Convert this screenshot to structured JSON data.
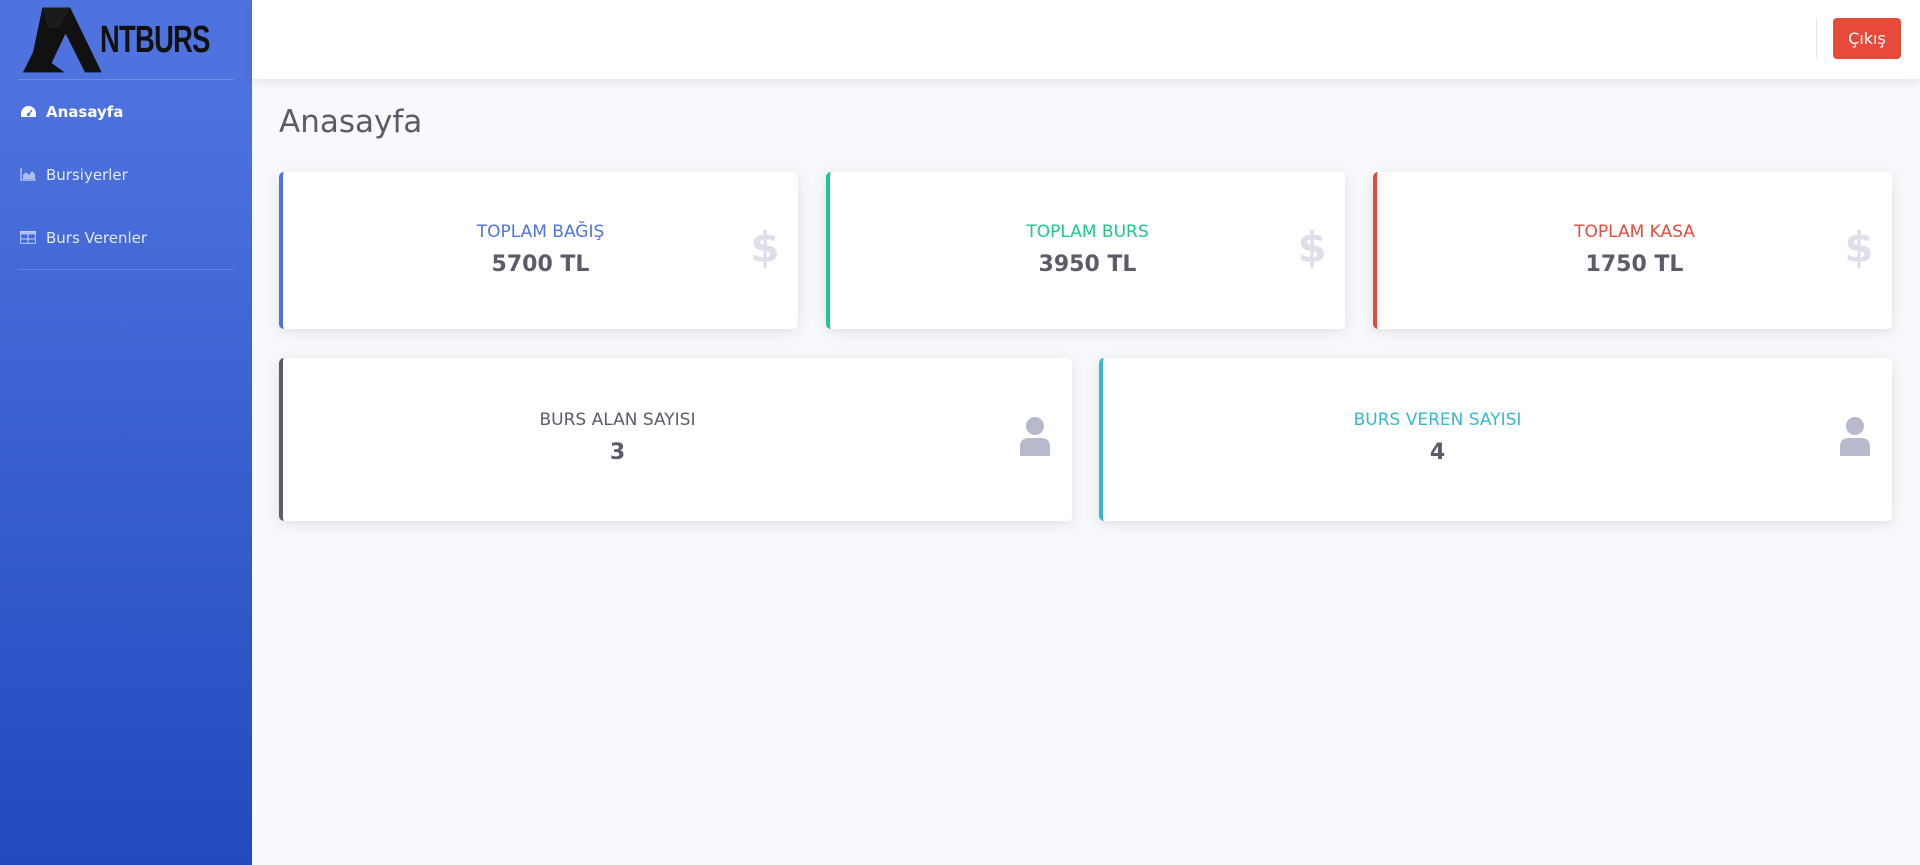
{
  "brand": {
    "name": "NTBURS"
  },
  "sidebar": {
    "items": [
      {
        "label": "Anasayfa",
        "icon": "dashboard-icon",
        "active": true
      },
      {
        "label": "Bursiyerler",
        "icon": "chart-area-icon",
        "active": false
      },
      {
        "label": "Burs Verenler",
        "icon": "table-icon",
        "active": false
      }
    ]
  },
  "topbar": {
    "logout_label": "Çıkış"
  },
  "page": {
    "title": "Anasayfa"
  },
  "cards": [
    {
      "label": "TOPLAM BAĞIŞ",
      "value": "5700 TL",
      "icon": "dollar-sign-icon",
      "accent": "#4e73df"
    },
    {
      "label": "TOPLAM BURS",
      "value": "3950 TL",
      "icon": "dollar-sign-icon",
      "accent": "#1cc88a"
    },
    {
      "label": "TOPLAM KASA",
      "value": "1750 TL",
      "icon": "dollar-sign-icon",
      "accent": "#e74a3b"
    },
    {
      "label": "BURS ALAN SAYISI",
      "value": "3",
      "icon": "user-icon",
      "accent": "#5a5c69"
    },
    {
      "label": "BURS VEREN SAYISI",
      "value": "4",
      "icon": "user-icon",
      "accent": "#36b9cc"
    }
  ],
  "colors": {
    "sidebar_top": "#4e73df",
    "sidebar_bottom": "#224abe",
    "logout_button": "#e74a3b",
    "icon_muted": "#dddfeb"
  }
}
